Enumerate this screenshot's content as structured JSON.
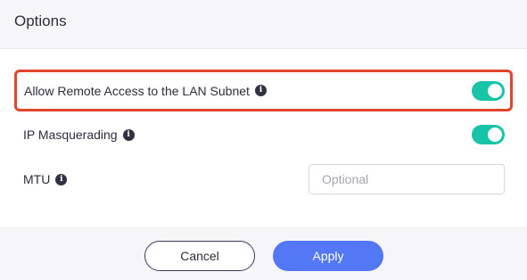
{
  "header": {
    "title": "Options"
  },
  "options": {
    "remote_access": {
      "label": "Allow Remote Access to the LAN Subnet",
      "enabled": true
    },
    "ip_masquerading": {
      "label": "IP Masquerading",
      "enabled": true
    },
    "mtu": {
      "label": "MTU",
      "value": "",
      "placeholder": "Optional"
    },
    "info_icon_glyph": "i"
  },
  "footer": {
    "cancel_label": "Cancel",
    "apply_label": "Apply"
  },
  "colors": {
    "toggle_on": "#17c4a8",
    "primary": "#5378f5",
    "highlight": "#e0462c"
  }
}
